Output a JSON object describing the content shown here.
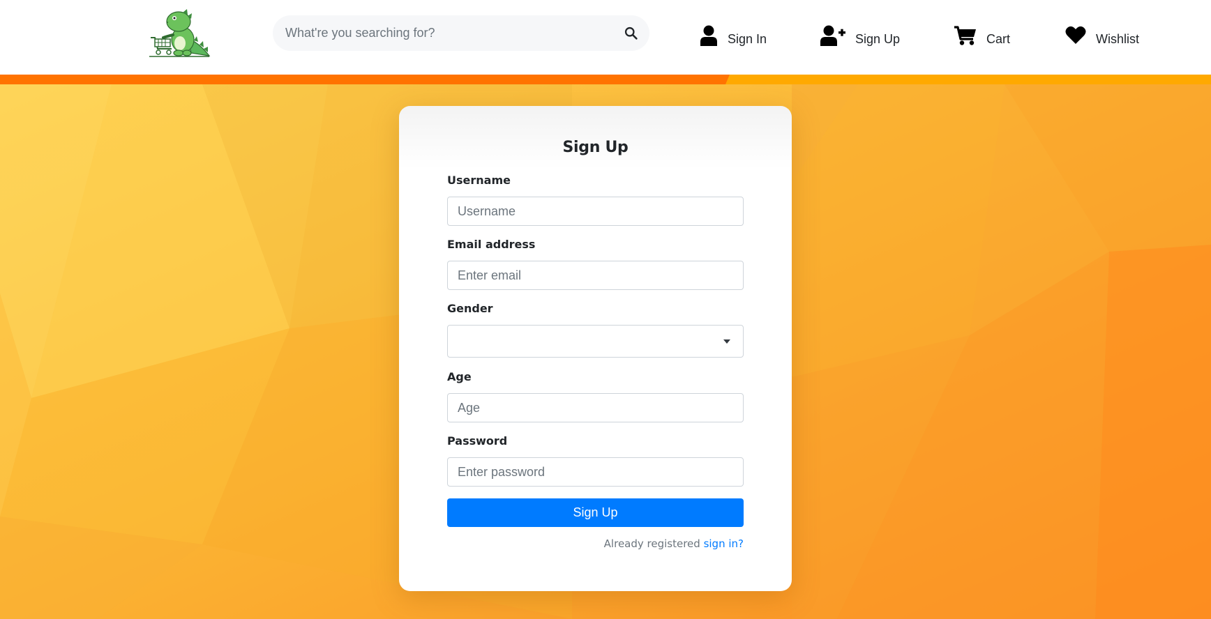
{
  "header": {
    "search": {
      "placeholder": "What're you searching for?"
    },
    "nav": {
      "sign_in": "Sign In",
      "sign_up": "Sign Up",
      "cart": "Cart",
      "wishlist": "Wishlist"
    },
    "icons": {
      "logo": "dinosaur-shopping-cart-logo",
      "search": "search-icon",
      "sign_in": "user-icon",
      "sign_up": "user-plus-icon",
      "cart": "cart-icon",
      "wishlist": "heart-icon"
    }
  },
  "form": {
    "title": "Sign Up",
    "username": {
      "label": "Username",
      "placeholder": "Username",
      "value": ""
    },
    "email": {
      "label": "Email address",
      "placeholder": "Enter email",
      "value": ""
    },
    "gender": {
      "label": "Gender",
      "selected": ""
    },
    "age": {
      "label": "Age",
      "placeholder": "Age",
      "value": ""
    },
    "password": {
      "label": "Password",
      "placeholder": "Enter password",
      "value": ""
    },
    "submit_label": "Sign Up",
    "signin_prompt": "Already registered",
    "signin_link": "sign in?"
  },
  "colors": {
    "accent_blue": "#007bff",
    "stripe_dark_orange": "#ff7a00",
    "stripe_light_orange": "#ffa800",
    "background_orange": "#fdb22e"
  }
}
